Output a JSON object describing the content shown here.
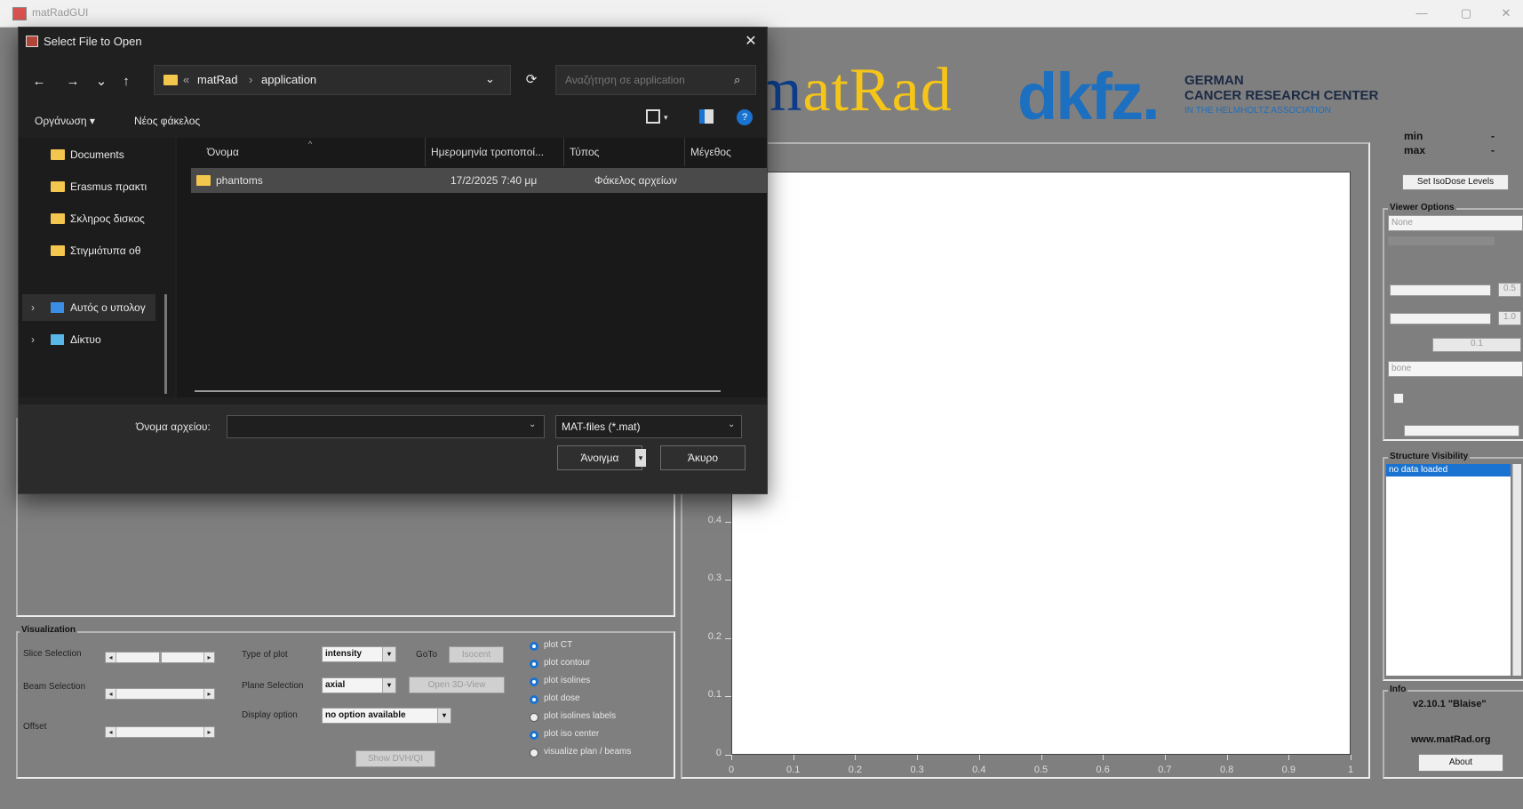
{
  "window": {
    "title": "matRadGUI",
    "minimize": "—",
    "maximize": "▢",
    "close": "✕"
  },
  "logos": {
    "matrad_mat": "m",
    "matrad_rest": "atRad",
    "dkfz": "dkfz.",
    "dkfz_line1": "GERMAN",
    "dkfz_line2": "CANCER RESEARCH CENTER",
    "dkfz_line3": "IN THE HELMHOLTZ ASSOCIATION"
  },
  "visualization": {
    "title": "Visualization",
    "slice_selection": "Slice Selection",
    "beam_selection": "Beam Selection",
    "offset": "Offset",
    "type_of_plot_label": "Type of plot",
    "type_of_plot_value": "intensity",
    "goto_label": "GoTo",
    "isocenter_button": "Isocent",
    "plane_selection_label": "Plane Selection",
    "plane_selection_value": "axial",
    "open_3d_button": "Open 3D-View",
    "display_option_label": "Display option",
    "display_option_value": "no option available",
    "show_dvh_button": "Show DVH/QI",
    "radio_options": [
      {
        "label": "plot CT",
        "on": true
      },
      {
        "label": "plot contour",
        "on": true
      },
      {
        "label": "plot isolines",
        "on": true
      },
      {
        "label": "plot dose",
        "on": true
      },
      {
        "label": "plot isolines labels",
        "on": false
      },
      {
        "label": "plot iso center",
        "on": true
      },
      {
        "label": "visualize plan / beams",
        "on": false
      }
    ]
  },
  "plot": {
    "y_ticks": [
      "0.4",
      "0.3",
      "0.2",
      "0.1",
      "0"
    ],
    "x_ticks": [
      "0",
      "0.1",
      "0.2",
      "0.3",
      "0.4",
      "0.5",
      "0.6",
      "0.7",
      "0.8",
      "0.9",
      "1"
    ]
  },
  "right_panel": {
    "min_label": "min",
    "max_label": "max",
    "min_value": "-",
    "max_value": "-",
    "set_isodose_button": "Set IsoDose Levels",
    "viewer_options_title": "Viewer Options",
    "viewer_dropdown_value": "None",
    "viewer_dropdown2_value": "bone",
    "value_box_1": "0.5",
    "value_box_2": "1.0",
    "value_box_3": "0.1",
    "structure_visibility_title": "Structure Visibility",
    "structure_item": "no data loaded",
    "info_title": "Info",
    "version": "v2.10.1 \"Blaise\"",
    "website": "www.matRad.org",
    "about_button": "About"
  },
  "dialog": {
    "title": "Select File to Open",
    "close": "✕",
    "nav": {
      "back": "←",
      "forward": "→",
      "recent": "⌄",
      "up": "↑"
    },
    "breadcrumb": {
      "root": "matRad",
      "current": "application",
      "separator1": "«",
      "separator2": "›"
    },
    "refresh": "⟳",
    "search_placeholder": "Αναζήτηση σε application",
    "toolbar": {
      "organize": "Οργάνωση ▾",
      "new_folder": "Νέος φάκελος"
    },
    "sidebar_items": [
      {
        "label": "Documents"
      },
      {
        "label": "Erasmus πρακτι"
      },
      {
        "label": "Σκληρος δισκος"
      },
      {
        "label": "Στιγμιότυπα οθ"
      }
    ],
    "sidebar_tree": [
      {
        "label": "Αυτός ο υπολογ"
      },
      {
        "label": "Δίκτυο"
      }
    ],
    "columns": {
      "name": "Όνομα",
      "date": "Ημερομηνία τροποποί...",
      "type": "Τύπος",
      "size": "Μέγεθος"
    },
    "files": [
      {
        "name": "phantoms",
        "date": "17/2/2025 7:40 μμ",
        "type": "Φάκελος αρχείων"
      }
    ],
    "filename_label": "Όνομα αρχείου:",
    "filename_value": "",
    "filter_value": "MAT-files (*.mat)",
    "open_button": "Άνοιγμα",
    "cancel_button": "Άκυρο"
  }
}
